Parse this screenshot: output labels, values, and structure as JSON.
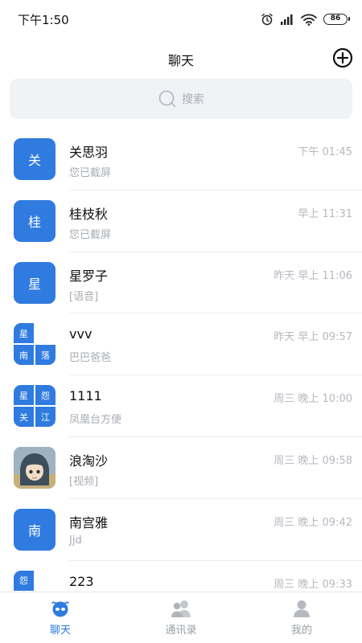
{
  "status_bar": {
    "time": "下午1:50",
    "battery": "86"
  },
  "header": {
    "title": "聊天"
  },
  "search": {
    "placeholder": "搜索"
  },
  "chats": [
    {
      "name": "关思羽",
      "preview": "您已截屏",
      "time": "下午 01:45",
      "avatar_text": "关"
    },
    {
      "name": "桂枝秋",
      "preview": "您已截屏",
      "time": "早上 11:31",
      "avatar_text": "桂"
    },
    {
      "name": "星罗子",
      "preview": "[语音]",
      "time": "昨天 早上 11:06",
      "avatar_text": "星"
    },
    {
      "name": "vvv",
      "preview": "巴巴爸爸",
      "time": "昨天 早上 09:57",
      "avatar_cells": [
        "星",
        "",
        "南",
        "落"
      ]
    },
    {
      "name": "1111",
      "preview": "凤凰台方便",
      "time": "周三 晚上 10:00",
      "avatar_cells": [
        "星",
        "怨",
        "关",
        "江"
      ]
    },
    {
      "name": "浪淘沙",
      "preview": "[视频]",
      "time": "周三 晚上 09:58"
    },
    {
      "name": "南宫雅",
      "preview": "Jjd",
      "time": "周三 晚上 09:42",
      "avatar_text": "南"
    },
    {
      "name": "223",
      "preview": "",
      "time": "周三 晚上 09:33",
      "avatar_cells": [
        "怨"
      ]
    }
  ],
  "tabs": [
    {
      "label": "聊天",
      "icon": "chat-icon",
      "active": true
    },
    {
      "label": "通讯录",
      "icon": "contacts-icon",
      "active": false
    },
    {
      "label": "我的",
      "icon": "profile-icon",
      "active": false
    }
  ],
  "colors": {
    "accent": "#2f7be0",
    "muted": "#a8adb3",
    "search_bg": "#f0f2f5"
  }
}
